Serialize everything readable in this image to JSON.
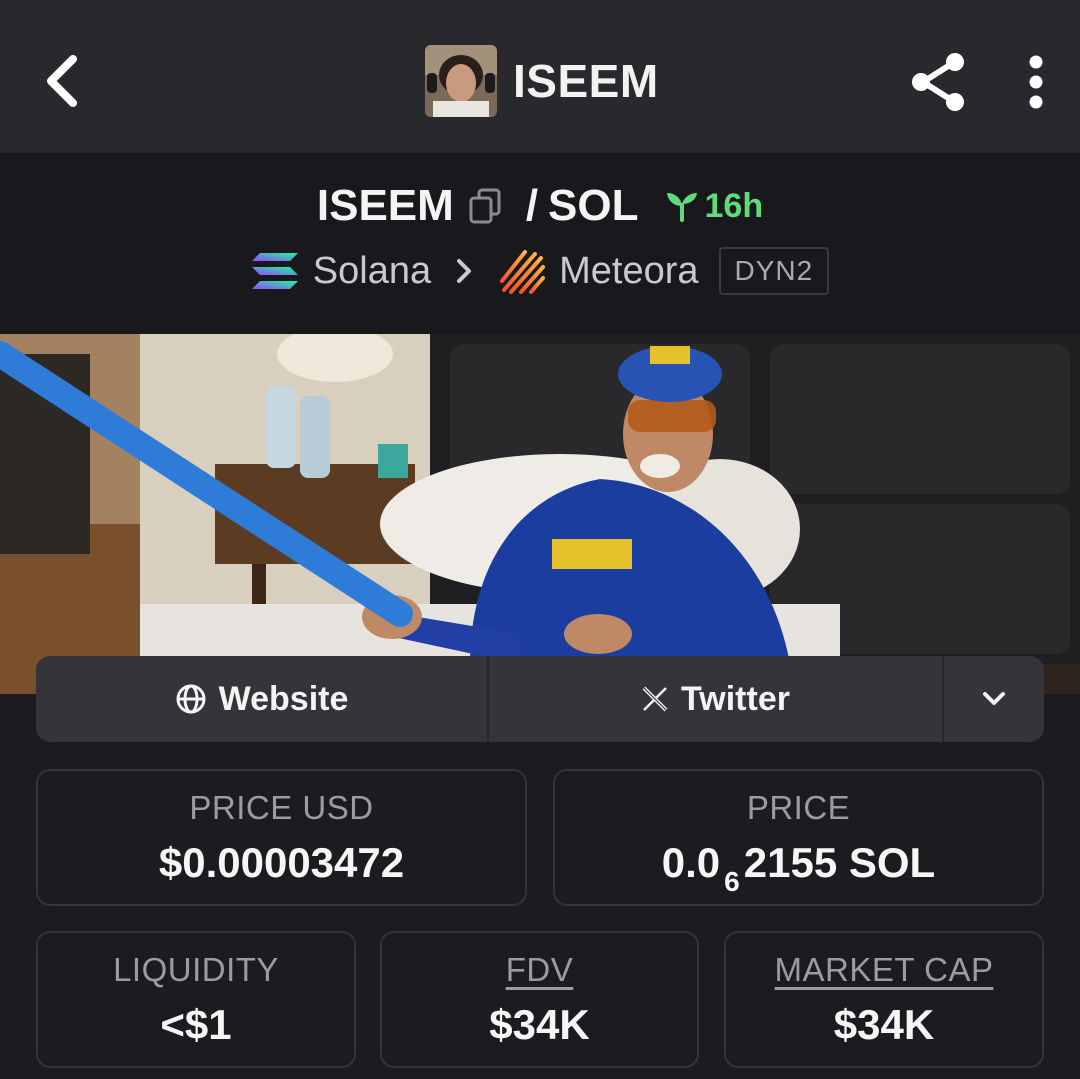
{
  "appbar": {
    "title": "ISEEM",
    "icons": {
      "back": "chevron-left-icon",
      "share": "share-icon",
      "more": "more-vertical-icon"
    }
  },
  "pair": {
    "base_symbol": "ISEEM",
    "separator": "/",
    "quote_symbol": "SOL",
    "age": "16h",
    "chain": "Solana",
    "dex": "Meteora",
    "dex_badge": "DYN2",
    "age_color": "#5fdb7b"
  },
  "links": {
    "website_label": "Website",
    "twitter_label": "Twitter"
  },
  "stats": {
    "price_usd": {
      "label": "PRICE USD",
      "value": "$0.00003472"
    },
    "price_native": {
      "label": "PRICE",
      "value_prefix": "0.0",
      "value_sub": "6",
      "value_suffix": "2155 SOL"
    },
    "liquidity": {
      "label": "LIQUIDITY",
      "value": "<$1"
    },
    "fdv": {
      "label": "FDV",
      "value": "$34K"
    },
    "market_cap": {
      "label": "MARKET CAP",
      "value": "$34K"
    }
  }
}
